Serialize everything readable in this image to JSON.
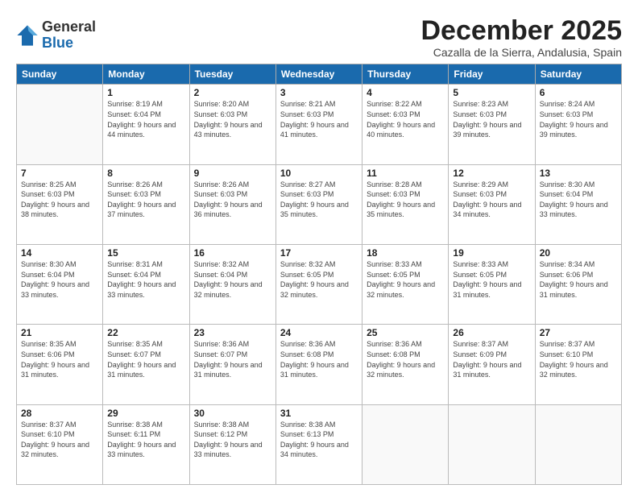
{
  "logo": {
    "general": "General",
    "blue": "Blue"
  },
  "header": {
    "month": "December 2025",
    "location": "Cazalla de la Sierra, Andalusia, Spain"
  },
  "weekdays": [
    "Sunday",
    "Monday",
    "Tuesday",
    "Wednesday",
    "Thursday",
    "Friday",
    "Saturday"
  ],
  "weeks": [
    [
      {
        "day": "",
        "sunrise": "",
        "sunset": "",
        "daylight": ""
      },
      {
        "day": "1",
        "sunrise": "Sunrise: 8:19 AM",
        "sunset": "Sunset: 6:04 PM",
        "daylight": "Daylight: 9 hours and 44 minutes."
      },
      {
        "day": "2",
        "sunrise": "Sunrise: 8:20 AM",
        "sunset": "Sunset: 6:03 PM",
        "daylight": "Daylight: 9 hours and 43 minutes."
      },
      {
        "day": "3",
        "sunrise": "Sunrise: 8:21 AM",
        "sunset": "Sunset: 6:03 PM",
        "daylight": "Daylight: 9 hours and 41 minutes."
      },
      {
        "day": "4",
        "sunrise": "Sunrise: 8:22 AM",
        "sunset": "Sunset: 6:03 PM",
        "daylight": "Daylight: 9 hours and 40 minutes."
      },
      {
        "day": "5",
        "sunrise": "Sunrise: 8:23 AM",
        "sunset": "Sunset: 6:03 PM",
        "daylight": "Daylight: 9 hours and 39 minutes."
      },
      {
        "day": "6",
        "sunrise": "Sunrise: 8:24 AM",
        "sunset": "Sunset: 6:03 PM",
        "daylight": "Daylight: 9 hours and 39 minutes."
      }
    ],
    [
      {
        "day": "7",
        "sunrise": "Sunrise: 8:25 AM",
        "sunset": "Sunset: 6:03 PM",
        "daylight": "Daylight: 9 hours and 38 minutes."
      },
      {
        "day": "8",
        "sunrise": "Sunrise: 8:26 AM",
        "sunset": "Sunset: 6:03 PM",
        "daylight": "Daylight: 9 hours and 37 minutes."
      },
      {
        "day": "9",
        "sunrise": "Sunrise: 8:26 AM",
        "sunset": "Sunset: 6:03 PM",
        "daylight": "Daylight: 9 hours and 36 minutes."
      },
      {
        "day": "10",
        "sunrise": "Sunrise: 8:27 AM",
        "sunset": "Sunset: 6:03 PM",
        "daylight": "Daylight: 9 hours and 35 minutes."
      },
      {
        "day": "11",
        "sunrise": "Sunrise: 8:28 AM",
        "sunset": "Sunset: 6:03 PM",
        "daylight": "Daylight: 9 hours and 35 minutes."
      },
      {
        "day": "12",
        "sunrise": "Sunrise: 8:29 AM",
        "sunset": "Sunset: 6:03 PM",
        "daylight": "Daylight: 9 hours and 34 minutes."
      },
      {
        "day": "13",
        "sunrise": "Sunrise: 8:30 AM",
        "sunset": "Sunset: 6:04 PM",
        "daylight": "Daylight: 9 hours and 33 minutes."
      }
    ],
    [
      {
        "day": "14",
        "sunrise": "Sunrise: 8:30 AM",
        "sunset": "Sunset: 6:04 PM",
        "daylight": "Daylight: 9 hours and 33 minutes."
      },
      {
        "day": "15",
        "sunrise": "Sunrise: 8:31 AM",
        "sunset": "Sunset: 6:04 PM",
        "daylight": "Daylight: 9 hours and 33 minutes."
      },
      {
        "day": "16",
        "sunrise": "Sunrise: 8:32 AM",
        "sunset": "Sunset: 6:04 PM",
        "daylight": "Daylight: 9 hours and 32 minutes."
      },
      {
        "day": "17",
        "sunrise": "Sunrise: 8:32 AM",
        "sunset": "Sunset: 6:05 PM",
        "daylight": "Daylight: 9 hours and 32 minutes."
      },
      {
        "day": "18",
        "sunrise": "Sunrise: 8:33 AM",
        "sunset": "Sunset: 6:05 PM",
        "daylight": "Daylight: 9 hours and 32 minutes."
      },
      {
        "day": "19",
        "sunrise": "Sunrise: 8:33 AM",
        "sunset": "Sunset: 6:05 PM",
        "daylight": "Daylight: 9 hours and 31 minutes."
      },
      {
        "day": "20",
        "sunrise": "Sunrise: 8:34 AM",
        "sunset": "Sunset: 6:06 PM",
        "daylight": "Daylight: 9 hours and 31 minutes."
      }
    ],
    [
      {
        "day": "21",
        "sunrise": "Sunrise: 8:35 AM",
        "sunset": "Sunset: 6:06 PM",
        "daylight": "Daylight: 9 hours and 31 minutes."
      },
      {
        "day": "22",
        "sunrise": "Sunrise: 8:35 AM",
        "sunset": "Sunset: 6:07 PM",
        "daylight": "Daylight: 9 hours and 31 minutes."
      },
      {
        "day": "23",
        "sunrise": "Sunrise: 8:36 AM",
        "sunset": "Sunset: 6:07 PM",
        "daylight": "Daylight: 9 hours and 31 minutes."
      },
      {
        "day": "24",
        "sunrise": "Sunrise: 8:36 AM",
        "sunset": "Sunset: 6:08 PM",
        "daylight": "Daylight: 9 hours and 31 minutes."
      },
      {
        "day": "25",
        "sunrise": "Sunrise: 8:36 AM",
        "sunset": "Sunset: 6:08 PM",
        "daylight": "Daylight: 9 hours and 32 minutes."
      },
      {
        "day": "26",
        "sunrise": "Sunrise: 8:37 AM",
        "sunset": "Sunset: 6:09 PM",
        "daylight": "Daylight: 9 hours and 31 minutes."
      },
      {
        "day": "27",
        "sunrise": "Sunrise: 8:37 AM",
        "sunset": "Sunset: 6:10 PM",
        "daylight": "Daylight: 9 hours and 32 minutes."
      }
    ],
    [
      {
        "day": "28",
        "sunrise": "Sunrise: 8:37 AM",
        "sunset": "Sunset: 6:10 PM",
        "daylight": "Daylight: 9 hours and 32 minutes."
      },
      {
        "day": "29",
        "sunrise": "Sunrise: 8:38 AM",
        "sunset": "Sunset: 6:11 PM",
        "daylight": "Daylight: 9 hours and 33 minutes."
      },
      {
        "day": "30",
        "sunrise": "Sunrise: 8:38 AM",
        "sunset": "Sunset: 6:12 PM",
        "daylight": "Daylight: 9 hours and 33 minutes."
      },
      {
        "day": "31",
        "sunrise": "Sunrise: 8:38 AM",
        "sunset": "Sunset: 6:13 PM",
        "daylight": "Daylight: 9 hours and 34 minutes."
      },
      {
        "day": "",
        "sunrise": "",
        "sunset": "",
        "daylight": ""
      },
      {
        "day": "",
        "sunrise": "",
        "sunset": "",
        "daylight": ""
      },
      {
        "day": "",
        "sunrise": "",
        "sunset": "",
        "daylight": ""
      }
    ]
  ]
}
